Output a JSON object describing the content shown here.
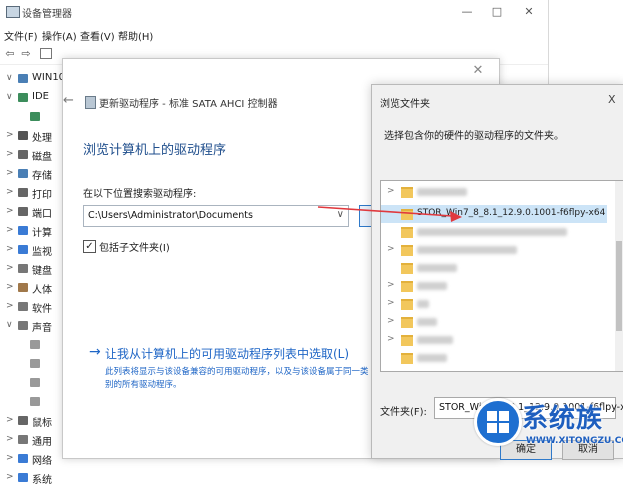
{
  "device_manager": {
    "title": "设备管理器",
    "window_controls": [
      "—",
      "□",
      "✕"
    ],
    "menu": [
      "文件(F)",
      "操作(A)",
      "查看(V)",
      "帮助(H)"
    ],
    "tree": [
      {
        "label": "WIN10",
        "expander": "∨",
        "icon": "computer-icon"
      },
      {
        "label": "IDE",
        "expander": "∨",
        "icon": "ide-controller-icon"
      },
      {
        "label": "",
        "expander": "",
        "icon": "sata-controller-icon"
      },
      {
        "label": "处理",
        "expander": ">",
        "icon": "processor-icon"
      },
      {
        "label": "磁盘",
        "expander": ">",
        "icon": "disk-drive-icon"
      },
      {
        "label": "存储",
        "expander": ">",
        "icon": "storage-icon"
      },
      {
        "label": "打印",
        "expander": ">",
        "icon": "printer-icon"
      },
      {
        "label": "端口",
        "expander": ">",
        "icon": "port-icon"
      },
      {
        "label": "计算",
        "expander": ">",
        "icon": "computer-icon"
      },
      {
        "label": "监视",
        "expander": ">",
        "icon": "monitor-icon"
      },
      {
        "label": "键盘",
        "expander": ">",
        "icon": "keyboard-icon"
      },
      {
        "label": "人体",
        "expander": ">",
        "icon": "hid-icon"
      },
      {
        "label": "软件",
        "expander": ">",
        "icon": "software-icon"
      },
      {
        "label": "声音",
        "expander": "∨",
        "icon": "sound-icon"
      },
      {
        "label": "",
        "expander": "",
        "icon": "audio-device-icon"
      },
      {
        "label": "",
        "expander": "",
        "icon": "audio-device-icon"
      },
      {
        "label": "",
        "expander": "",
        "icon": "audio-device-icon"
      },
      {
        "label": "",
        "expander": "",
        "icon": "audio-device-icon"
      },
      {
        "label": "鼠标",
        "expander": ">",
        "icon": "mouse-icon"
      },
      {
        "label": "通用",
        "expander": ">",
        "icon": "usb-icon"
      },
      {
        "label": "网络",
        "expander": ">",
        "icon": "network-icon"
      },
      {
        "label": "系统",
        "expander": ">",
        "icon": "system-icon"
      }
    ]
  },
  "update_dialog": {
    "close": "✕",
    "back": "←",
    "title": "更新驱动程序 - 标准 SATA AHCI 控制器",
    "heading": "浏览计算机上的驱动程序",
    "search_label": "在以下位置搜索驱动程序:",
    "path_value": "C:\\Users\\Administrator\\Documents",
    "path_dropdown": "∨",
    "include_subfolders": "包括子文件夹(I)",
    "include_checked": "☑",
    "pick_arrow": "→",
    "pick_link": "让我从计算机上的可用驱动程序列表中选取(L)",
    "pick_desc": "此列表将显示与该设备兼容的可用驱动程序，以及与该设备属于同一类别的所有驱动程序。"
  },
  "browse_dialog": {
    "title": "浏览文件夹",
    "close": "X",
    "prompt": "选择包含你的硬件的驱动程序的文件夹。",
    "selected_folder": "STOR_Win7_8_8.1_12.9.0.1001-f6flpy-x64",
    "folder_label": "文件夹(F):",
    "folder_value": "STOR_Win7_8_8.1_12.9.0.1001-f6flpy-x64",
    "ok": "确定",
    "cancel": "取消"
  },
  "watermark": {
    "brand": "系统族",
    "url": "WWW.XITONGZU.COM"
  },
  "colors": {
    "link_blue": "#1f66c6",
    "arrow_red": "#e0393e",
    "selection": "#cce4f7"
  }
}
